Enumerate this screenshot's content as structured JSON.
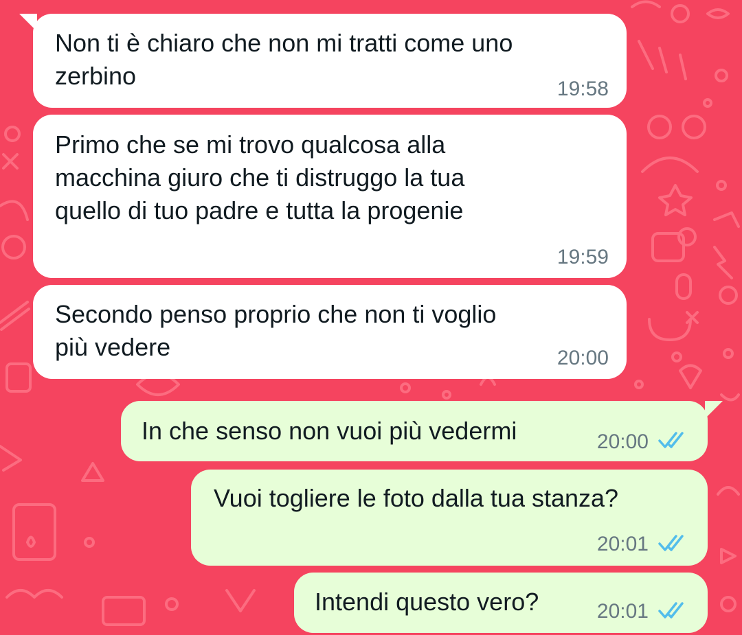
{
  "colors": {
    "wallpaper": "#f5445f",
    "incoming_bubble": "#ffffff",
    "outgoing_bubble": "#e7fed8",
    "text": "#111b21",
    "timestamp": "#667781",
    "read_check": "#53bdeb"
  },
  "messages": [
    {
      "direction": "incoming",
      "text": "Non ti è chiaro che non mi tratti come uno\nzerbino",
      "time": "19:58"
    },
    {
      "direction": "incoming",
      "text": "Primo che se mi trovo qualcosa alla\nmacchina giuro che ti distruggo la tua\nquello di tuo padre e tutta la progenie",
      "time": "19:59"
    },
    {
      "direction": "incoming",
      "text": "Secondo penso proprio che non ti voglio\npiù vedere",
      "time": "20:00"
    },
    {
      "direction": "outgoing",
      "text": "In che senso non vuoi più vedermi",
      "time": "20:00",
      "status_icon": "double-check-read-icon"
    },
    {
      "direction": "outgoing",
      "text": "Vuoi togliere le foto dalla tua stanza?",
      "time": "20:01",
      "status_icon": "double-check-read-icon"
    },
    {
      "direction": "outgoing",
      "text": "Intendi questo vero?",
      "time": "20:01",
      "status_icon": "double-check-read-icon"
    }
  ]
}
